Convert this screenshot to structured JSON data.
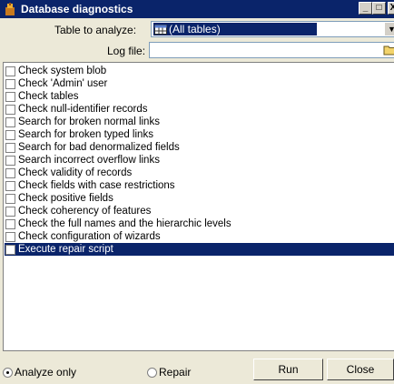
{
  "window": {
    "title": "Database diagnostics",
    "controls": {
      "minimize": "_",
      "maximize": "□",
      "close": "X"
    }
  },
  "table_to_analyze": {
    "label": "Table to analyze:",
    "value": "(All tables)"
  },
  "log_file": {
    "label": "Log file:",
    "value": ""
  },
  "checks": {
    "items": [
      {
        "label": "Check system blob",
        "checked": false
      },
      {
        "label": "Check 'Admin' user",
        "checked": false
      },
      {
        "label": "Check tables",
        "checked": false
      },
      {
        "label": "Check null-identifier records",
        "checked": false
      },
      {
        "label": "Search for broken normal links",
        "checked": false
      },
      {
        "label": "Search for broken typed links",
        "checked": false
      },
      {
        "label": "Search for bad denormalized fields",
        "checked": false
      },
      {
        "label": "Search incorrect overflow links",
        "checked": false
      },
      {
        "label": "Check validity of records",
        "checked": false
      },
      {
        "label": "Check fields with case restrictions",
        "checked": false
      },
      {
        "label": "Check positive fields",
        "checked": false
      },
      {
        "label": "Check coherency of features",
        "checked": false
      },
      {
        "label": "Check the full names and the hierarchic levels",
        "checked": false
      },
      {
        "label": "Check configuration of wizards",
        "checked": false
      },
      {
        "label": "Execute repair script",
        "checked": false,
        "selected": true
      }
    ]
  },
  "mode": {
    "analyze_only": "Analyze only",
    "repair": "Repair",
    "selected": "Analyze only"
  },
  "buttons": {
    "run": "Run",
    "close": "Close"
  },
  "colors": {
    "titlebar": "#0a246a",
    "selection": "#0a246a",
    "dialog_bg": "#ece9d8"
  }
}
